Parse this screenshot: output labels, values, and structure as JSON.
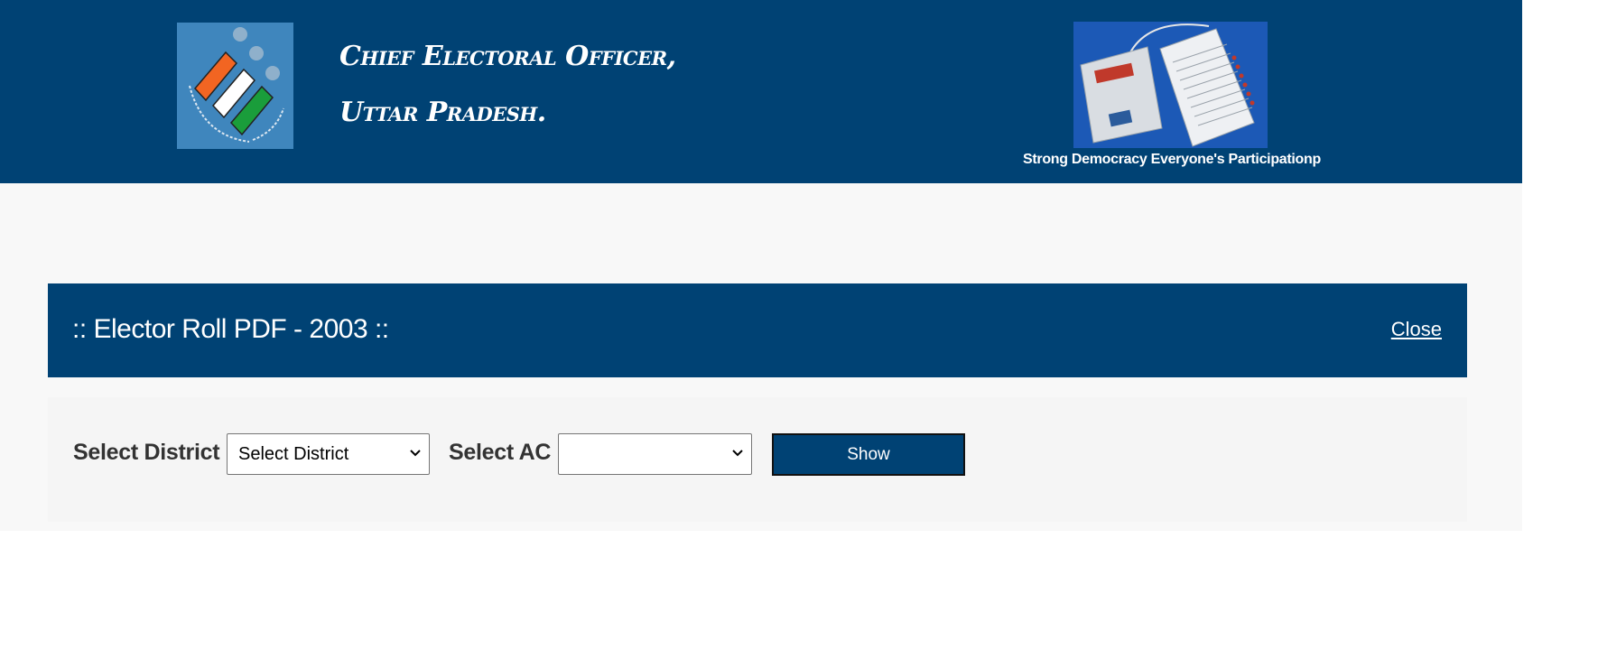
{
  "header": {
    "title_line1": "Chief Electoral Officer,",
    "title_line2": "Uttar Pradesh.",
    "tagline": "Strong Democracy Everyone's Participationp",
    "logo_icon": "eci-logo-icon",
    "evm_icon": "evm-machine-image"
  },
  "panel": {
    "title": ":: Elector Roll PDF - 2003 ::",
    "close_label": "Close"
  },
  "form": {
    "district_label": "Select District",
    "district_value": "Select District",
    "ac_label": "Select AC",
    "ac_value": "",
    "show_label": "Show"
  },
  "colors": {
    "header_bg": "#004274",
    "content_bg": "#f8f8f8",
    "logo_bg": "#3f86bd"
  }
}
